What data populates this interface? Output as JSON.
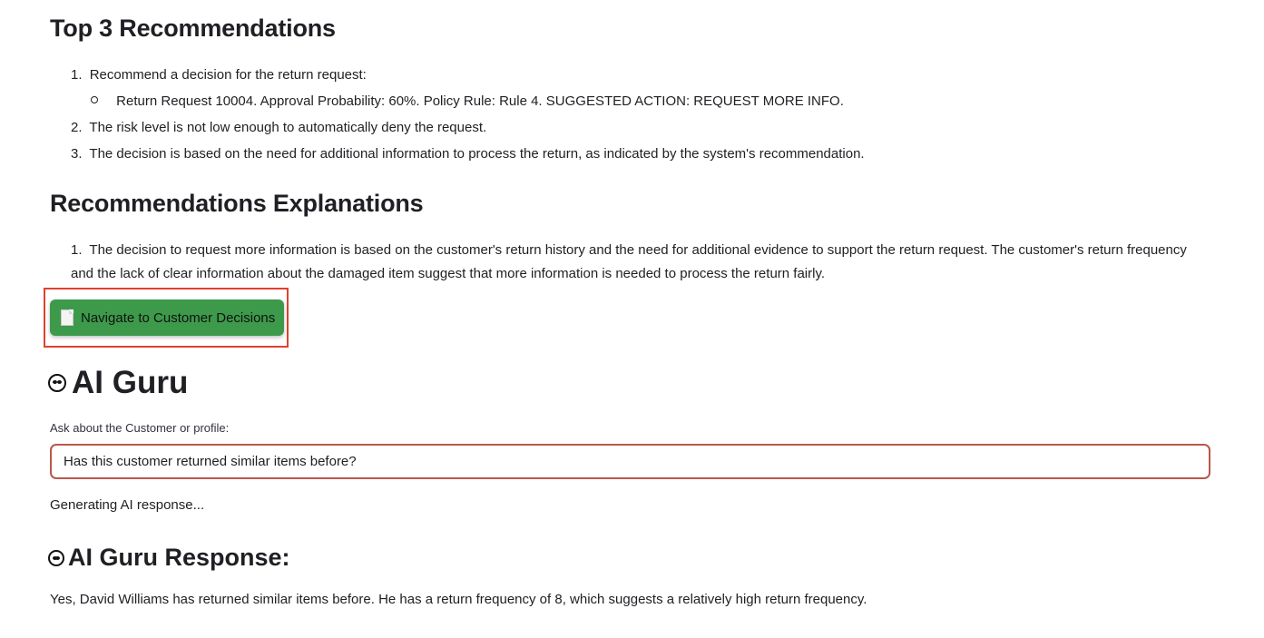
{
  "top3": {
    "heading": "Top 3 Recommendations",
    "items": [
      {
        "num": "1.",
        "text": "Recommend a decision for the return request:"
      },
      {
        "sub": "Return Request 10004. Approval Probability: 60%. Policy Rule: Rule 4. SUGGESTED ACTION: REQUEST MORE INFO."
      },
      {
        "num": "2.",
        "text": "The risk level is not low enough to automatically deny the request."
      },
      {
        "num": "3.",
        "text": "The decision is based on the need for additional information to process the return, as indicated by the system's recommendation."
      }
    ]
  },
  "explanations": {
    "heading": "Recommendations Explanations",
    "items": [
      {
        "num": "1.",
        "text": "The decision to request more information is based on the customer's return history and the need for additional evidence to support the return request. The customer's return frequency and the lack of clear information about the damaged item suggest that more information is needed to process the return fairly."
      }
    ]
  },
  "nav_button": {
    "label": "Navigate to Customer Decisions",
    "icon": "document-icon",
    "color": "#3d9a4a",
    "highlight_color": "#e0412f"
  },
  "guru": {
    "title": "AI Guru",
    "icon": "alien-icon",
    "input_label": "Ask about the Customer or profile:",
    "input_value": "Has this customer returned similar items before?",
    "status": "Generating AI response...",
    "response_heading": "AI Guru Response:",
    "response_text": "Yes, David Williams has returned similar items before. He has a return frequency of 8, which suggests a relatively high return frequency."
  }
}
